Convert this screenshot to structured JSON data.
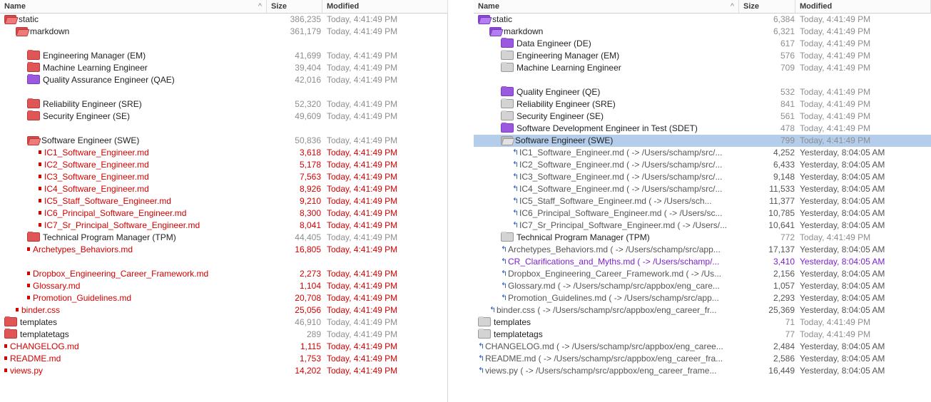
{
  "columns": {
    "name": "Name",
    "size": "Size",
    "modified": "Modified"
  },
  "colors": {
    "modified_red": "#d40000",
    "unmodified_gray": "#8e8e8e",
    "linked_purple": "#7a1fd0",
    "selection": "#b3cdeb"
  },
  "left": {
    "rows": [
      {
        "indent": 0,
        "icon": "open-folder-red-icon",
        "name": "static",
        "size": "386,235",
        "modified": "Today, 4:41:49 PM",
        "tone": "blk",
        "ctone": "gry"
      },
      {
        "indent": 1,
        "icon": "open-folder-red-icon",
        "name": "markdown",
        "size": "361,179",
        "modified": "Today, 4:41:49 PM",
        "tone": "blk",
        "ctone": "gry"
      },
      {
        "blank": true
      },
      {
        "indent": 2,
        "icon": "folder-red-icon",
        "name": "Engineering Manager (EM)",
        "size": "41,699",
        "modified": "Today, 4:41:49 PM",
        "tone": "blk",
        "ctone": "gry"
      },
      {
        "indent": 2,
        "icon": "folder-red-icon",
        "name": "Machine Learning Engineer",
        "size": "39,404",
        "modified": "Today, 4:41:49 PM",
        "tone": "blk",
        "ctone": "gry"
      },
      {
        "indent": 2,
        "icon": "folder-purple-icon",
        "name": "Quality Assurance Engineer (QAE)",
        "size": "42,016",
        "modified": "Today, 4:41:49 PM",
        "tone": "blk",
        "ctone": "gry"
      },
      {
        "blank": true
      },
      {
        "indent": 2,
        "icon": "folder-red-icon",
        "name": "Reliability Engineer (SRE)",
        "size": "52,320",
        "modified": "Today, 4:41:49 PM",
        "tone": "blk",
        "ctone": "gry"
      },
      {
        "indent": 2,
        "icon": "folder-red-icon",
        "name": "Security Engineer (SE)",
        "size": "49,609",
        "modified": "Today, 4:41:49 PM",
        "tone": "blk",
        "ctone": "gry"
      },
      {
        "blank": true
      },
      {
        "indent": 2,
        "icon": "open-folder-red-icon",
        "name": "Software Engineer (SWE)",
        "size": "50,836",
        "modified": "Today, 4:41:49 PM",
        "tone": "blk",
        "ctone": "gry"
      },
      {
        "indent": 3,
        "icon": "file-red-icon",
        "name": "IC1_Software_Engineer.md",
        "size": "3,618",
        "modified": "Today, 4:41:49 PM",
        "tone": "red",
        "ctone": "red"
      },
      {
        "indent": 3,
        "icon": "file-red-icon",
        "name": "IC2_Software_Engineer.md",
        "size": "5,178",
        "modified": "Today, 4:41:49 PM",
        "tone": "red",
        "ctone": "red"
      },
      {
        "indent": 3,
        "icon": "file-red-icon",
        "name": "IC3_Software_Engineer.md",
        "size": "7,563",
        "modified": "Today, 4:41:49 PM",
        "tone": "red",
        "ctone": "red"
      },
      {
        "indent": 3,
        "icon": "file-red-icon",
        "name": "IC4_Software_Engineer.md",
        "size": "8,926",
        "modified": "Today, 4:41:49 PM",
        "tone": "red",
        "ctone": "red"
      },
      {
        "indent": 3,
        "icon": "file-red-icon",
        "name": "IC5_Staff_Software_Engineer.md",
        "size": "9,210",
        "modified": "Today, 4:41:49 PM",
        "tone": "red",
        "ctone": "red"
      },
      {
        "indent": 3,
        "icon": "file-red-icon",
        "name": "IC6_Principal_Software_Engineer.md",
        "size": "8,300",
        "modified": "Today, 4:41:49 PM",
        "tone": "red",
        "ctone": "red"
      },
      {
        "indent": 3,
        "icon": "file-red-icon",
        "name": "IC7_Sr_Principal_Software_Engineer.md",
        "size": "8,041",
        "modified": "Today, 4:41:49 PM",
        "tone": "red",
        "ctone": "red"
      },
      {
        "indent": 2,
        "icon": "folder-red-icon",
        "name": "Technical Program Manager (TPM)",
        "size": "44,405",
        "modified": "Today, 4:41:49 PM",
        "tone": "blk",
        "ctone": "gry"
      },
      {
        "indent": 2,
        "icon": "file-red-icon",
        "name": "Archetypes_Behaviors.md",
        "size": "16,805",
        "modified": "Today, 4:41:49 PM",
        "tone": "red",
        "ctone": "red"
      },
      {
        "blank": true
      },
      {
        "indent": 2,
        "icon": "file-red-icon",
        "name": "Dropbox_Engineering_Career_Framework.md",
        "size": "2,273",
        "modified": "Today, 4:41:49 PM",
        "tone": "red",
        "ctone": "red"
      },
      {
        "indent": 2,
        "icon": "file-red-icon",
        "name": "Glossary.md",
        "size": "1,104",
        "modified": "Today, 4:41:49 PM",
        "tone": "red",
        "ctone": "red"
      },
      {
        "indent": 2,
        "icon": "file-red-icon",
        "name": "Promotion_Guidelines.md",
        "size": "20,708",
        "modified": "Today, 4:41:49 PM",
        "tone": "red",
        "ctone": "red"
      },
      {
        "indent": 1,
        "icon": "file-red-icon",
        "name": "binder.css",
        "size": "25,056",
        "modified": "Today, 4:41:49 PM",
        "tone": "red",
        "ctone": "red"
      },
      {
        "indent": 0,
        "icon": "folder-red-icon",
        "name": "templates",
        "size": "46,910",
        "modified": "Today, 4:41:49 PM",
        "tone": "blk",
        "ctone": "gry"
      },
      {
        "indent": 0,
        "icon": "folder-red-icon",
        "name": "templatetags",
        "size": "289",
        "modified": "Today, 4:41:49 PM",
        "tone": "blk",
        "ctone": "gry"
      },
      {
        "indent": 0,
        "icon": "file-red-icon",
        "name": "CHANGELOG.md",
        "size": "1,115",
        "modified": "Today, 4:41:49 PM",
        "tone": "red",
        "ctone": "red"
      },
      {
        "indent": 0,
        "icon": "file-red-icon",
        "name": "README.md",
        "size": "1,753",
        "modified": "Today, 4:41:49 PM",
        "tone": "red",
        "ctone": "red"
      },
      {
        "indent": 0,
        "icon": "file-red-icon",
        "name": "views.py",
        "size": "14,202",
        "modified": "Today, 4:41:49 PM",
        "tone": "red",
        "ctone": "red"
      }
    ]
  },
  "right": {
    "rows": [
      {
        "indent": 0,
        "icon": "open-folder-purple-icon",
        "name": "static",
        "size": "6,384",
        "modified": "Today, 4:41:49 PM",
        "tone": "blk",
        "ctone": "gry"
      },
      {
        "indent": 1,
        "icon": "open-folder-purple-icon",
        "name": "markdown",
        "size": "6,321",
        "modified": "Today, 4:41:49 PM",
        "tone": "blk",
        "ctone": "gry"
      },
      {
        "indent": 2,
        "icon": "folder-purple-icon",
        "name": "Data Engineer (DE)",
        "size": "617",
        "modified": "Today, 4:41:49 PM",
        "tone": "blk",
        "ctone": "gry"
      },
      {
        "indent": 2,
        "icon": "folder-gray-icon",
        "name": "Engineering Manager (EM)",
        "size": "576",
        "modified": "Today, 4:41:49 PM",
        "tone": "blk",
        "ctone": "gry"
      },
      {
        "indent": 2,
        "icon": "folder-gray-icon",
        "name": "Machine Learning Engineer",
        "size": "709",
        "modified": "Today, 4:41:49 PM",
        "tone": "blk",
        "ctone": "gry"
      },
      {
        "blank": true
      },
      {
        "indent": 2,
        "icon": "folder-purple-icon",
        "name": "Quality Engineer (QE)",
        "size": "532",
        "modified": "Today, 4:41:49 PM",
        "tone": "blk",
        "ctone": "gry"
      },
      {
        "indent": 2,
        "icon": "folder-gray-icon",
        "name": "Reliability Engineer (SRE)",
        "size": "841",
        "modified": "Today, 4:41:49 PM",
        "tone": "blk",
        "ctone": "gry"
      },
      {
        "indent": 2,
        "icon": "folder-gray-icon",
        "name": "Security Engineer (SE)",
        "size": "561",
        "modified": "Today, 4:41:49 PM",
        "tone": "blk",
        "ctone": "gry"
      },
      {
        "indent": 2,
        "icon": "folder-purple-icon",
        "name": "Software Development Engineer in Test (SDET)",
        "size": "478",
        "modified": "Today, 4:41:49 PM",
        "tone": "blk",
        "ctone": "gry"
      },
      {
        "indent": 2,
        "icon": "open-folder-gray-icon",
        "name": "Software Engineer (SWE)",
        "size": "799",
        "modified": "Today, 4:41:49 PM",
        "tone": "blk",
        "ctone": "gry",
        "selected": true
      },
      {
        "indent": 3,
        "icon": "symlink-icon",
        "name": "IC1_Software_Engineer.md ( -> /Users/schamp/src/...",
        "size": "4,252",
        "modified": "Yesterday, 8:04:05 AM",
        "tone": "dk",
        "ctone": "dk"
      },
      {
        "indent": 3,
        "icon": "symlink-icon",
        "name": "IC2_Software_Engineer.md ( -> /Users/schamp/src/...",
        "size": "6,433",
        "modified": "Yesterday, 8:04:05 AM",
        "tone": "dk",
        "ctone": "dk"
      },
      {
        "indent": 3,
        "icon": "symlink-icon",
        "name": "IC3_Software_Engineer.md ( -> /Users/schamp/src/...",
        "size": "9,148",
        "modified": "Yesterday, 8:04:05 AM",
        "tone": "dk",
        "ctone": "dk"
      },
      {
        "indent": 3,
        "icon": "symlink-icon",
        "name": "IC4_Software_Engineer.md ( -> /Users/schamp/src/...",
        "size": "11,533",
        "modified": "Yesterday, 8:04:05 AM",
        "tone": "dk",
        "ctone": "dk"
      },
      {
        "indent": 3,
        "icon": "symlink-icon",
        "name": "IC5_Staff_Software_Engineer.md ( -> /Users/sch...",
        "size": "11,377",
        "modified": "Yesterday, 8:04:05 AM",
        "tone": "dk",
        "ctone": "dk"
      },
      {
        "indent": 3,
        "icon": "symlink-icon",
        "name": "IC6_Principal_Software_Engineer.md ( -> /Users/sc...",
        "size": "10,785",
        "modified": "Yesterday, 8:04:05 AM",
        "tone": "dk",
        "ctone": "dk"
      },
      {
        "indent": 3,
        "icon": "symlink-icon",
        "name": "IC7_Sr_Principal_Software_Engineer.md ( -> /Users/...",
        "size": "10,641",
        "modified": "Yesterday, 8:04:05 AM",
        "tone": "dk",
        "ctone": "dk"
      },
      {
        "indent": 2,
        "icon": "folder-gray-icon",
        "name": "Technical Program Manager (TPM)",
        "size": "772",
        "modified": "Today, 4:41:49 PM",
        "tone": "blk",
        "ctone": "gry"
      },
      {
        "indent": 2,
        "icon": "symlink-icon",
        "name": "Archetypes_Behaviors.md ( -> /Users/schamp/src/app...",
        "size": "17,137",
        "modified": "Yesterday, 8:04:05 AM",
        "tone": "dk",
        "ctone": "dk"
      },
      {
        "indent": 2,
        "icon": "symlink-icon",
        "name": "CR_Clarifications_and_Myths.md ( -> /Users/schamp/...",
        "size": "3,410",
        "modified": "Yesterday, 8:04:05 AM",
        "tone": "pur",
        "ctone": "pur"
      },
      {
        "indent": 2,
        "icon": "symlink-icon",
        "name": "Dropbox_Engineering_Career_Framework.md ( -> /Us...",
        "size": "2,156",
        "modified": "Yesterday, 8:04:05 AM",
        "tone": "dk",
        "ctone": "dk"
      },
      {
        "indent": 2,
        "icon": "symlink-icon",
        "name": "Glossary.md ( -> /Users/schamp/src/appbox/eng_care...",
        "size": "1,057",
        "modified": "Yesterday, 8:04:05 AM",
        "tone": "dk",
        "ctone": "dk"
      },
      {
        "indent": 2,
        "icon": "symlink-icon",
        "name": "Promotion_Guidelines.md ( -> /Users/schamp/src/app...",
        "size": "2,293",
        "modified": "Yesterday, 8:04:05 AM",
        "tone": "dk",
        "ctone": "dk"
      },
      {
        "indent": 1,
        "icon": "symlink-icon",
        "name": "binder.css ( -> /Users/schamp/src/appbox/eng_career_fr...",
        "size": "25,369",
        "modified": "Yesterday, 8:04:05 AM",
        "tone": "dk",
        "ctone": "dk"
      },
      {
        "indent": 0,
        "icon": "folder-gray-icon",
        "name": "templates",
        "size": "71",
        "modified": "Today, 4:41:49 PM",
        "tone": "blk",
        "ctone": "gry"
      },
      {
        "indent": 0,
        "icon": "folder-gray-icon",
        "name": "templatetags",
        "size": "77",
        "modified": "Today, 4:41:49 PM",
        "tone": "blk",
        "ctone": "gry"
      },
      {
        "indent": 0,
        "icon": "symlink-icon",
        "name": "CHANGELOG.md ( -> /Users/schamp/src/appbox/eng_caree...",
        "size": "2,484",
        "modified": "Yesterday, 8:04:05 AM",
        "tone": "dk",
        "ctone": "dk"
      },
      {
        "indent": 0,
        "icon": "symlink-icon",
        "name": "README.md ( -> /Users/schamp/src/appbox/eng_career_fra...",
        "size": "2,586",
        "modified": "Yesterday, 8:04:05 AM",
        "tone": "dk",
        "ctone": "dk"
      },
      {
        "indent": 0,
        "icon": "symlink-icon",
        "name": "views.py ( -> /Users/schamp/src/appbox/eng_career_frame...",
        "size": "16,449",
        "modified": "Yesterday, 8:04:05 AM",
        "tone": "dk",
        "ctone": "dk"
      }
    ]
  }
}
